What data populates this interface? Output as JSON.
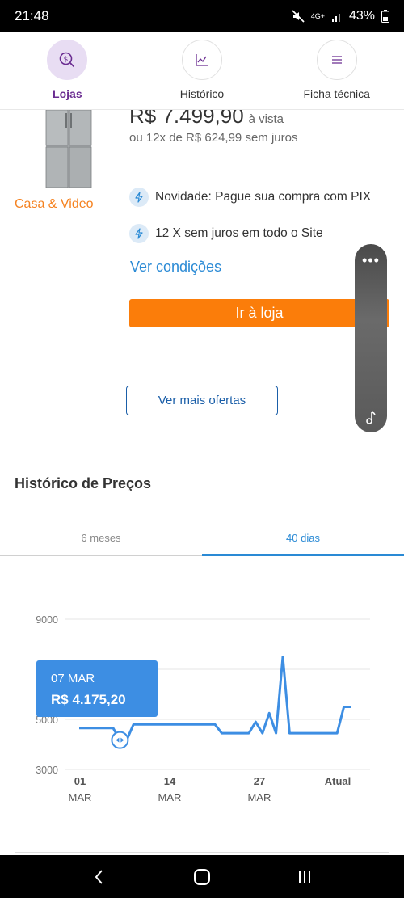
{
  "status": {
    "time": "21:48",
    "network": "4G+",
    "battery": "43%"
  },
  "nav": {
    "tabs": [
      {
        "label": "Lojas",
        "icon": "search-money-icon",
        "active": true
      },
      {
        "label": "Histórico",
        "icon": "chart-line-icon",
        "active": false
      },
      {
        "label": "Ficha técnica",
        "icon": "list-icon",
        "active": false
      }
    ]
  },
  "offer": {
    "store": "Casa & Video",
    "price": "R$ 7.499,90",
    "price_suffix": "à vista",
    "installments": "ou 12x de R$ 624,99 sem juros",
    "features": [
      "Novidade: Pague sua compra com PIX",
      "12 X sem juros em todo o Site"
    ],
    "conditions_link": "Ver condições",
    "goto_button": "Ir à loja"
  },
  "more_offers_button": "Ver mais ofertas",
  "history": {
    "title": "Histórico de Preços",
    "period_tabs": [
      {
        "label": "6 meses",
        "active": false
      },
      {
        "label": "40 dias",
        "active": true
      }
    ],
    "tooltip": {
      "date": "07 MAR",
      "price": "R$ 4.175,20"
    }
  },
  "chart_data": {
    "type": "line",
    "y_ticks": [
      "9000",
      "7000",
      "5000",
      "3000"
    ],
    "ylim": [
      3000,
      9000
    ],
    "x_tick_labels": [
      {
        "top": "01",
        "bottom": "MAR"
      },
      {
        "top": "14",
        "bottom": "MAR"
      },
      {
        "top": "27",
        "bottom": "MAR"
      },
      {
        "top": "Atual",
        "bottom": ""
      }
    ],
    "x": [
      0,
      1,
      2,
      3,
      4,
      5,
      6,
      7,
      8,
      9,
      10,
      11,
      12,
      13,
      14,
      15,
      16,
      17,
      18,
      19,
      20,
      21,
      22,
      23,
      24,
      25,
      26,
      27,
      28,
      29,
      30,
      31,
      32,
      33,
      34,
      35,
      36,
      37,
      38,
      39,
      40
    ],
    "series": [
      {
        "values": [
          4650,
          4650,
          4650,
          4650,
          4650,
          4650,
          4175,
          4175,
          4800,
          4800,
          4800,
          4800,
          4800,
          4800,
          4800,
          4800,
          4800,
          4800,
          4800,
          4800,
          4800,
          4450,
          4450,
          4450,
          4450,
          4450,
          4900,
          4450,
          5250,
          4450,
          7500,
          4450,
          4450,
          4450,
          4450,
          4450,
          4450,
          4450,
          4450,
          5500,
          5500
        ]
      }
    ],
    "color": "#3d8ee3",
    "grid": true
  }
}
